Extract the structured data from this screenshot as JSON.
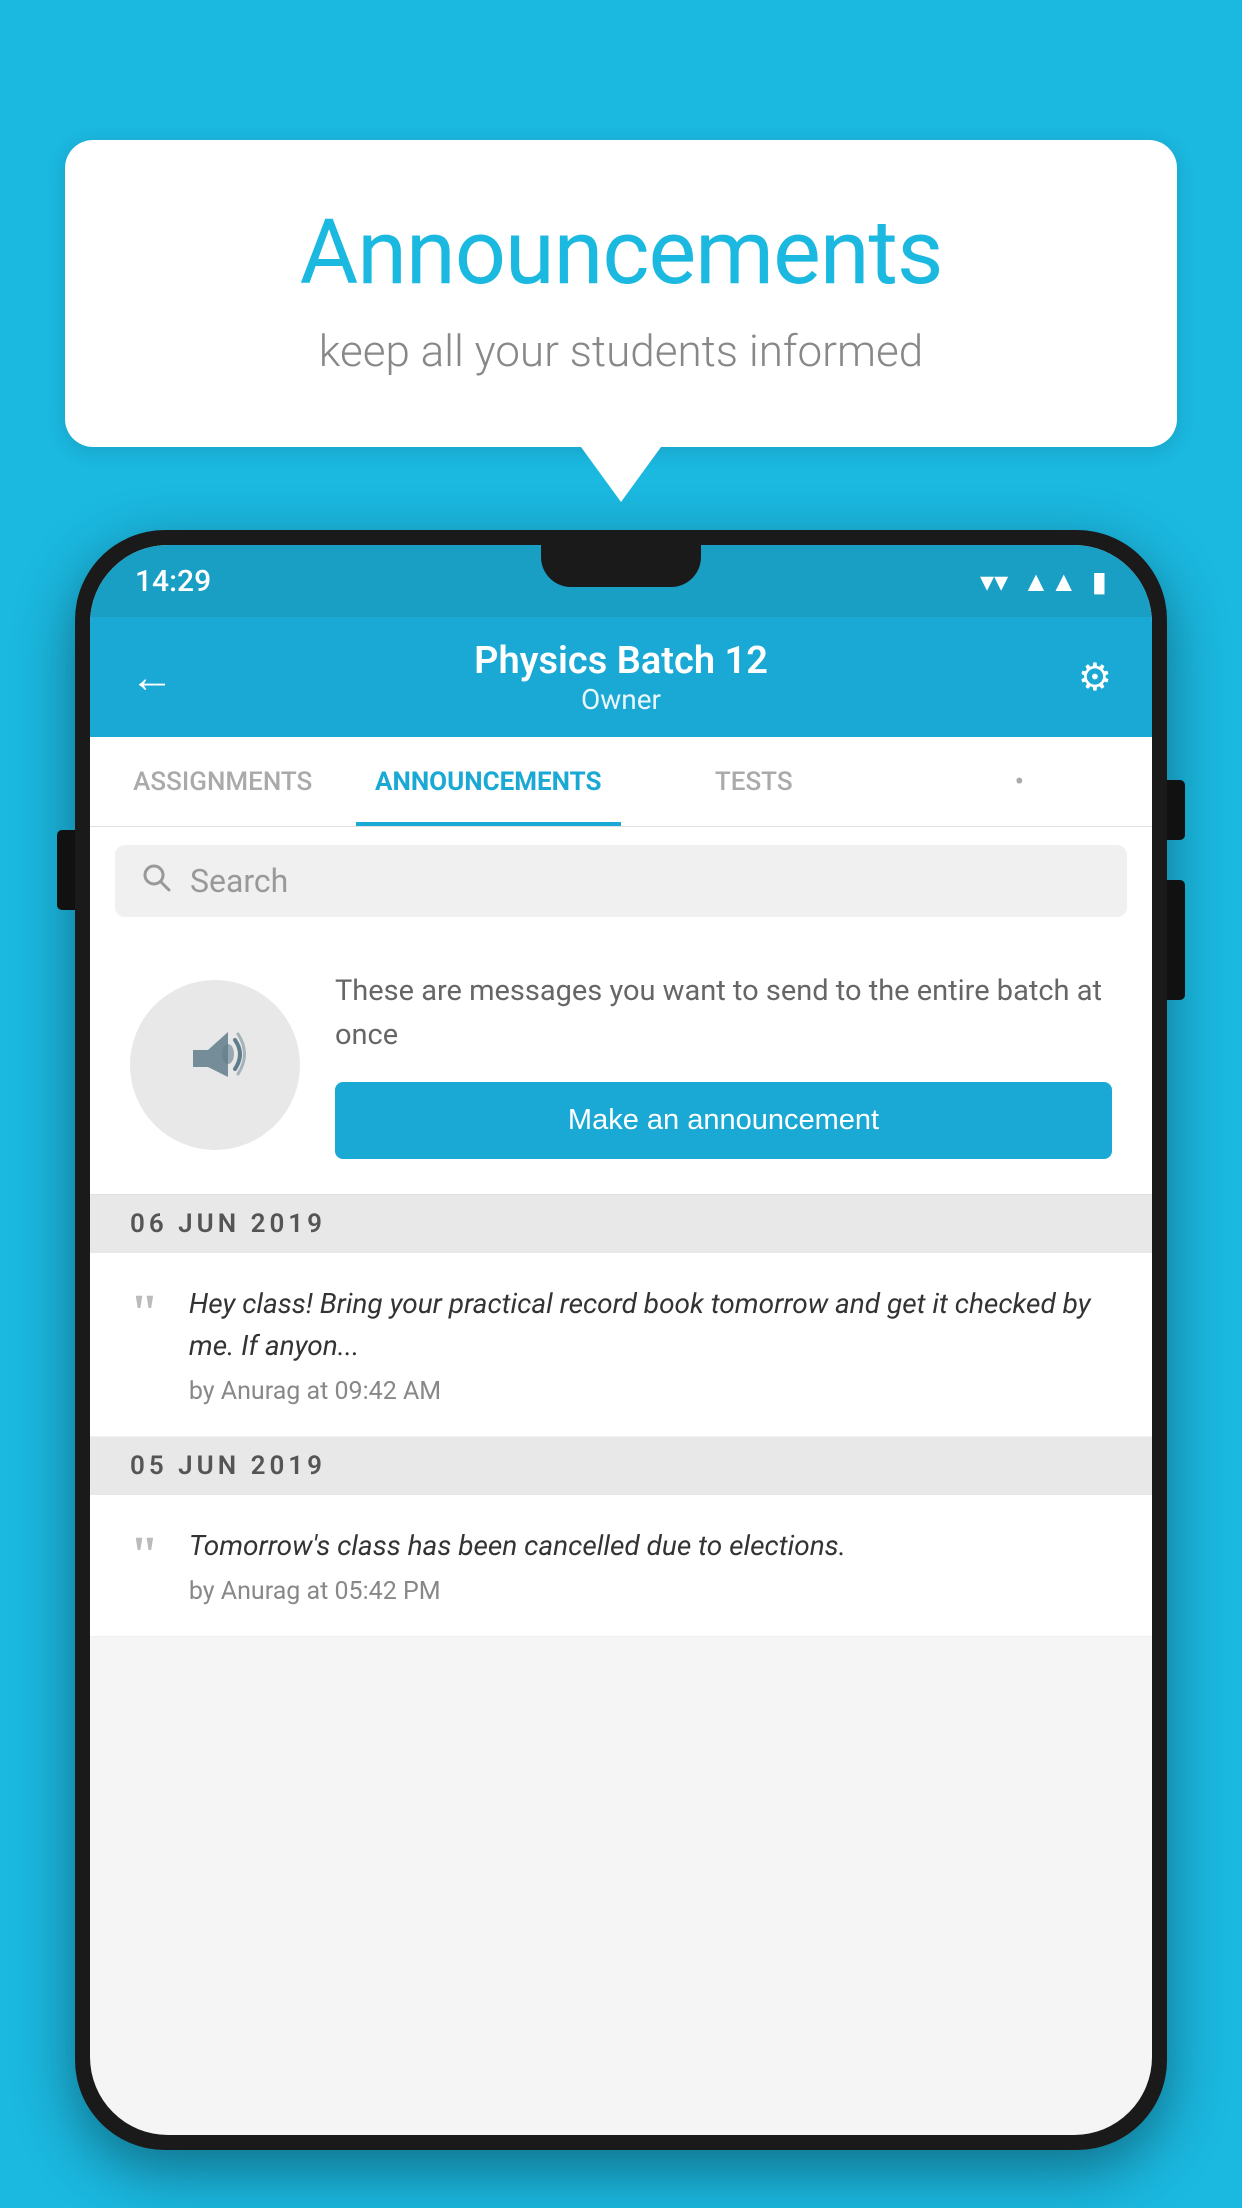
{
  "header": {
    "title": "Announcements",
    "subtitle": "keep all your students informed"
  },
  "phone": {
    "status_time": "14:29",
    "app_bar": {
      "title": "Physics Batch 12",
      "subtitle": "Owner",
      "back_label": "←",
      "settings_label": "⚙"
    },
    "tabs": [
      {
        "label": "ASSIGNMENTS",
        "active": false
      },
      {
        "label": "ANNOUNCEMENTS",
        "active": true
      },
      {
        "label": "TESTS",
        "active": false
      },
      {
        "label": "•",
        "active": false
      }
    ],
    "search": {
      "placeholder": "Search"
    },
    "announcement_prompt": {
      "description": "These are messages you want to send to the entire batch at once",
      "button_label": "Make an announcement"
    },
    "announcement_groups": [
      {
        "date": "06  JUN  2019",
        "items": [
          {
            "text": "Hey class! Bring your practical record book tomorrow and get it checked by me. If anyon...",
            "meta": "by Anurag at 09:42 AM"
          }
        ]
      },
      {
        "date": "05  JUN  2019",
        "items": [
          {
            "text": "Tomorrow's class has been cancelled due to elections.",
            "meta": "by Anurag at 05:42 PM"
          }
        ]
      }
    ]
  },
  "colors": {
    "primary": "#1aa8d4",
    "background": "#1bb8e0",
    "white": "#ffffff"
  }
}
